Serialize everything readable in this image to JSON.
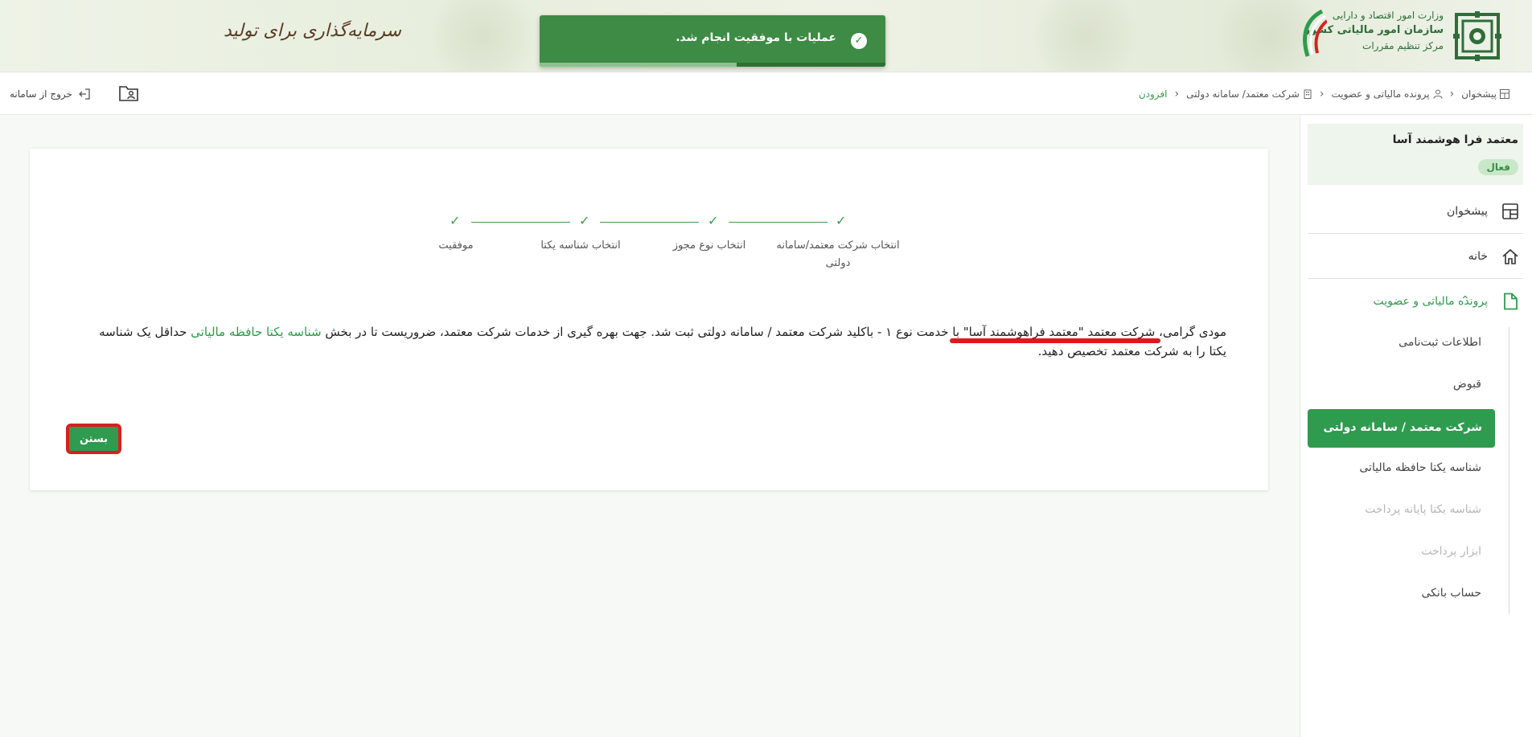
{
  "banner": {
    "ministry_line1": "وزارت امور اقتصاد و دارایی",
    "ministry_line2": "سازمان امور مالیاتی کشور",
    "ministry_line3": "مرکز تنظیم مقررات",
    "slogan": "سرمایه‌گذاری برای تولید"
  },
  "toast": {
    "message": "عملیات با موفقیت انجام شد.",
    "progress": 0.57,
    "icon": "check-circle-icon"
  },
  "breadcrumb": [
    {
      "label": "پیشخوان",
      "icon": "dashboard-icon"
    },
    {
      "label": "پرونده مالیاتی و عضویت",
      "icon": "user-icon"
    },
    {
      "label": "شرکت معتمد/ سامانه دولتی",
      "icon": "building-icon"
    },
    {
      "label": "افزودن",
      "icon": ""
    }
  ],
  "topbar": {
    "logout_label": "خروج از سامانه"
  },
  "sidebar": {
    "profile_name": "معتمد فرا هوشمند آسا",
    "profile_status": "فعال",
    "menu": [
      {
        "label": "پیشخوان",
        "icon": "dashboard-icon"
      },
      {
        "label": "خانه",
        "icon": "home-icon"
      },
      {
        "label": "پرونده مالیاتی و عضویت",
        "icon": "document-icon"
      }
    ],
    "sub_items": [
      {
        "label": "اطلاعات ثبت‌نامی",
        "disabled": false
      },
      {
        "label": "قبوض",
        "disabled": false
      },
      {
        "label": "شرکت معتمد / سامانه دولتی",
        "active": true
      },
      {
        "label": "شناسه یکتا حافظه مالیاتی",
        "disabled": false
      },
      {
        "label": "شناسه یکتا پایانه پرداخت",
        "disabled": true
      },
      {
        "label": "ابزار پرداخت",
        "disabled": true
      },
      {
        "label": "حساب بانکی",
        "disabled": false
      }
    ]
  },
  "stepper": {
    "steps": [
      "انتخاب شرکت معتمد/سامانه دولتی",
      "انتخاب نوع مجوز",
      "انتخاب شناسه یکتا",
      "موفقیت"
    ]
  },
  "message": {
    "part1": "مودی گرامی، ",
    "company": "شرکت معتمد \"معتمد فراهوشمند آسا\"",
    "part2": " با خدمت نوع ۱ - باکلید شرکت معتمد / سامانه دولتی ثبت شد. جهت بهره گیری از خدمات شرکت معتمد، ضروریست تا در بخش ",
    "link": "شناسه یکتا حافظه مالیاتی",
    "part3": " حداقل یک شناسه یکتا را به شرکت معتمد تخصیص دهید."
  },
  "close_button": "بستن",
  "colors": {
    "accent": "#2e9b4e",
    "toast": "#3d8b44",
    "highlight": "#d62020"
  }
}
